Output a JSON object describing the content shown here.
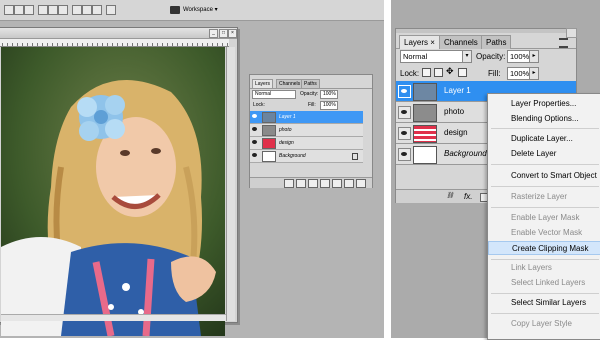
{
  "left_screen": {
    "optbar": {
      "workspace_label": "Workspace ▾"
    },
    "small_layers_panel": {
      "tabs": [
        "Layers",
        "Channels",
        "Paths"
      ],
      "blend_mode": "Normal",
      "opacity_label": "Opacity:",
      "opacity_value": "100%",
      "lock_label": "Lock:",
      "fill_label": "Fill:",
      "fill_value": "100%",
      "layers": [
        {
          "name": "Layer 1",
          "selected": true
        },
        {
          "name": "photo",
          "selected": false
        },
        {
          "name": "design",
          "selected": false
        },
        {
          "name": "Background",
          "selected": false
        }
      ]
    }
  },
  "right_screen": {
    "layers_panel": {
      "tabs": [
        "Layers",
        "Channels",
        "Paths"
      ],
      "tab_close": "×",
      "blend_mode": "Normal",
      "opacity_label": "Opacity:",
      "opacity_value": "100%",
      "lock_label": "Lock:",
      "fill_label": "Fill:",
      "fill_value": "100%",
      "layers": [
        {
          "name": "Layer 1",
          "selected": true
        },
        {
          "name": "photo",
          "selected": false
        },
        {
          "name": "design",
          "selected": false
        },
        {
          "name": "Background",
          "selected": false
        }
      ],
      "bottom_fx": "fx."
    },
    "context_menu": {
      "items": [
        {
          "label": "Layer Properties...",
          "disabled": false
        },
        {
          "label": "Blending Options...",
          "disabled": false
        },
        {
          "label": "Duplicate Layer...",
          "disabled": false
        },
        {
          "label": "Delete Layer",
          "disabled": false
        },
        {
          "label": "Convert to Smart Object",
          "disabled": false
        },
        {
          "label": "Rasterize Layer",
          "disabled": true
        },
        {
          "label": "Enable Layer Mask",
          "disabled": true
        },
        {
          "label": "Enable Vector Mask",
          "disabled": true
        },
        {
          "label": "Create Clipping Mask",
          "disabled": false,
          "highlighted": true
        },
        {
          "label": "Link Layers",
          "disabled": true
        },
        {
          "label": "Select Linked Layers",
          "disabled": true
        },
        {
          "label": "Select Similar Layers",
          "disabled": false
        },
        {
          "label": "Copy Layer Style",
          "disabled": true
        }
      ]
    }
  },
  "colors": {
    "selection_blue": "#2f8ff0",
    "design_thumb_red": "#e0304a"
  }
}
